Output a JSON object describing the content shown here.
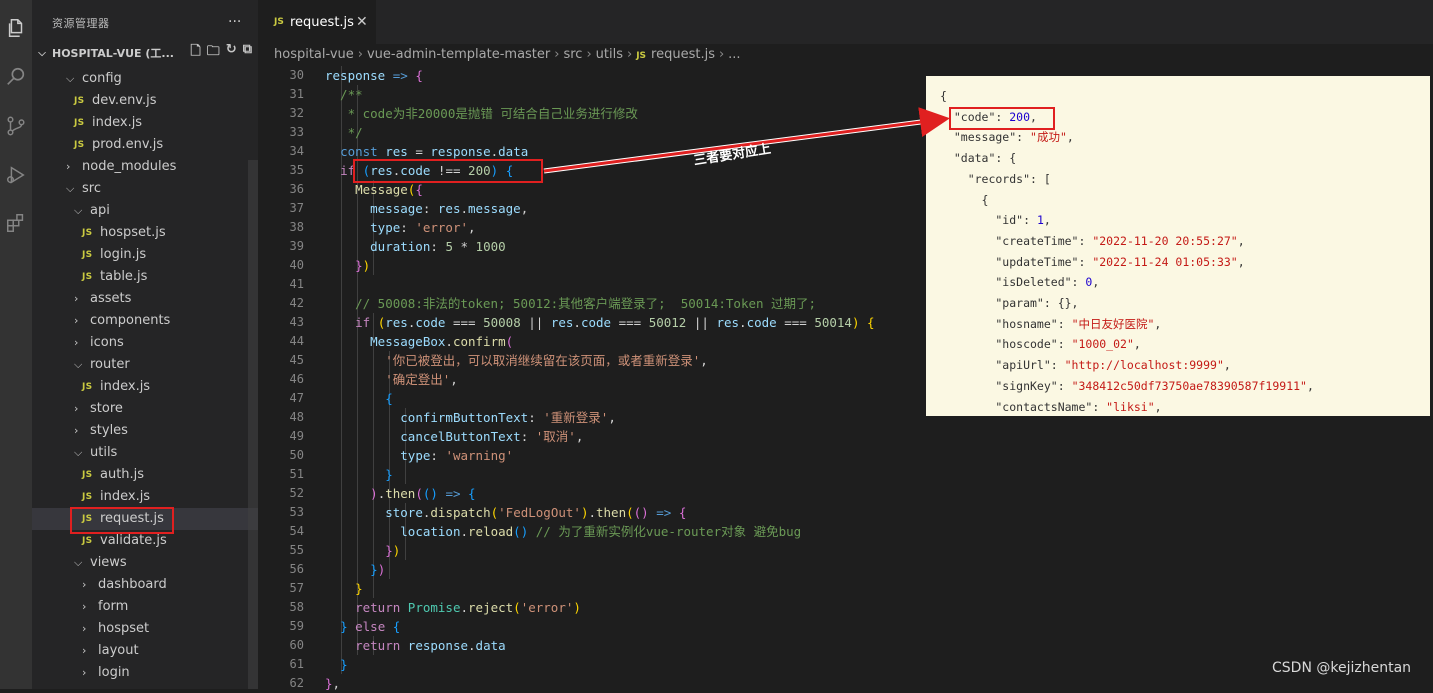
{
  "sidebar": {
    "title": "资源管理器",
    "more": "···",
    "project": "HOSPITAL-VUE (工...",
    "tree": [
      {
        "name": "config",
        "type": "folder",
        "open": true,
        "depth": 1
      },
      {
        "name": "dev.env.js",
        "type": "js",
        "depth": 2,
        "active": true
      },
      {
        "name": "index.js",
        "type": "js",
        "depth": 2
      },
      {
        "name": "prod.env.js",
        "type": "js",
        "depth": 2
      },
      {
        "name": "node_modules",
        "type": "folder",
        "open": false,
        "depth": 1
      },
      {
        "name": "src",
        "type": "folder",
        "open": true,
        "depth": 1
      },
      {
        "name": "api",
        "type": "folder",
        "open": true,
        "depth": 2
      },
      {
        "name": "hospset.js",
        "type": "js",
        "depth": 3
      },
      {
        "name": "login.js",
        "type": "js",
        "depth": 3
      },
      {
        "name": "table.js",
        "type": "js",
        "depth": 3
      },
      {
        "name": "assets",
        "type": "folder",
        "open": false,
        "depth": 2
      },
      {
        "name": "components",
        "type": "folder",
        "open": false,
        "depth": 2
      },
      {
        "name": "icons",
        "type": "folder",
        "open": false,
        "depth": 2
      },
      {
        "name": "router",
        "type": "folder",
        "open": true,
        "depth": 2
      },
      {
        "name": "index.js",
        "type": "js",
        "depth": 3
      },
      {
        "name": "store",
        "type": "folder",
        "open": false,
        "depth": 2
      },
      {
        "name": "styles",
        "type": "folder",
        "open": false,
        "depth": 2
      },
      {
        "name": "utils",
        "type": "folder",
        "open": true,
        "depth": 2
      },
      {
        "name": "auth.js",
        "type": "js",
        "depth": 3
      },
      {
        "name": "index.js",
        "type": "js",
        "depth": 3
      },
      {
        "name": "request.js",
        "type": "js",
        "depth": 3,
        "selected": true
      },
      {
        "name": "validate.js",
        "type": "js",
        "depth": 3
      },
      {
        "name": "views",
        "type": "folder",
        "open": true,
        "depth": 2
      },
      {
        "name": "dashboard",
        "type": "folder",
        "open": false,
        "depth": 3
      },
      {
        "name": "form",
        "type": "folder",
        "open": false,
        "depth": 3
      },
      {
        "name": "hospset",
        "type": "folder",
        "open": false,
        "depth": 3
      },
      {
        "name": "layout",
        "type": "folder",
        "open": false,
        "depth": 3
      },
      {
        "name": "login",
        "type": "folder",
        "open": false,
        "depth": 3
      }
    ]
  },
  "tab": {
    "icon": "JS",
    "name": "request.js",
    "close": "✕"
  },
  "breadcrumb": {
    "parts": [
      "hospital-vue",
      "vue-admin-template-master",
      "src",
      "utils"
    ],
    "file_icon": "JS",
    "file": "request.js",
    "tail": "..."
  },
  "code": {
    "line_numbers": [
      30,
      31,
      32,
      33,
      34,
      35,
      36,
      37,
      38,
      39,
      40,
      41,
      42,
      43,
      44,
      45,
      46,
      47,
      48,
      49,
      50,
      51,
      52,
      53,
      54,
      55,
      56,
      57,
      58,
      59,
      60,
      61,
      62
    ],
    "lines": [
      [
        [
          0,
          "p",
          ""
        ],
        [
          0,
          "var",
          "response"
        ],
        [
          0,
          "p",
          " "
        ],
        [
          0,
          "kw",
          "=>"
        ],
        [
          0,
          "p",
          " "
        ],
        [
          0,
          "b2",
          "{"
        ]
      ],
      [
        [
          0,
          "cm",
          "  /**"
        ]
      ],
      [
        [
          0,
          "cm",
          "   * code为非20000是抛错 可结合自己业务进行修改"
        ]
      ],
      [
        [
          0,
          "cm",
          "   */"
        ]
      ],
      [
        [
          0,
          "p",
          "  "
        ],
        [
          0,
          "kw",
          "const"
        ],
        [
          0,
          "p",
          " "
        ],
        [
          0,
          "var",
          "res"
        ],
        [
          0,
          "p",
          " = "
        ],
        [
          0,
          "var",
          "response"
        ],
        [
          0,
          "p",
          "."
        ],
        [
          0,
          "var",
          "data"
        ]
      ],
      [
        [
          0,
          "p",
          "  "
        ],
        [
          0,
          "ctl",
          "if"
        ],
        [
          0,
          "p",
          " "
        ],
        [
          0,
          "b3",
          "("
        ],
        [
          0,
          "var",
          "res"
        ],
        [
          0,
          "p",
          "."
        ],
        [
          0,
          "var",
          "code"
        ],
        [
          0,
          "p",
          " !== "
        ],
        [
          0,
          "num",
          "200"
        ],
        [
          0,
          "b3",
          ")"
        ],
        [
          0,
          "p",
          " "
        ],
        [
          0,
          "b3",
          "{"
        ]
      ],
      [
        [
          0,
          "p",
          "    "
        ],
        [
          0,
          "fn",
          "Message"
        ],
        [
          0,
          "b1",
          "("
        ],
        [
          0,
          "b2",
          "{"
        ]
      ],
      [
        [
          0,
          "p",
          "      "
        ],
        [
          0,
          "var",
          "message"
        ],
        [
          0,
          "p",
          ": "
        ],
        [
          0,
          "var",
          "res"
        ],
        [
          0,
          "p",
          "."
        ],
        [
          0,
          "var",
          "message"
        ],
        [
          0,
          "p",
          ","
        ]
      ],
      [
        [
          0,
          "p",
          "      "
        ],
        [
          0,
          "var",
          "type"
        ],
        [
          0,
          "p",
          ": "
        ],
        [
          0,
          "str",
          "'error'"
        ],
        [
          0,
          "p",
          ","
        ]
      ],
      [
        [
          0,
          "p",
          "      "
        ],
        [
          0,
          "var",
          "duration"
        ],
        [
          0,
          "p",
          ": "
        ],
        [
          0,
          "num",
          "5"
        ],
        [
          0,
          "p",
          " * "
        ],
        [
          0,
          "num",
          "1000"
        ]
      ],
      [
        [
          0,
          "p",
          "    "
        ],
        [
          0,
          "b2",
          "}"
        ],
        [
          0,
          "b1",
          ")"
        ]
      ],
      [
        [
          0,
          "p",
          ""
        ]
      ],
      [
        [
          0,
          "p",
          "    "
        ],
        [
          0,
          "cm",
          "// 50008:非法的token; 50012:其他客户端登录了;  50014:Token 过期了;"
        ]
      ],
      [
        [
          0,
          "p",
          "    "
        ],
        [
          0,
          "ctl",
          "if"
        ],
        [
          0,
          "p",
          " "
        ],
        [
          0,
          "b1",
          "("
        ],
        [
          0,
          "var",
          "res"
        ],
        [
          0,
          "p",
          "."
        ],
        [
          0,
          "var",
          "code"
        ],
        [
          0,
          "p",
          " === "
        ],
        [
          0,
          "num",
          "50008"
        ],
        [
          0,
          "p",
          " || "
        ],
        [
          0,
          "var",
          "res"
        ],
        [
          0,
          "p",
          "."
        ],
        [
          0,
          "var",
          "code"
        ],
        [
          0,
          "p",
          " === "
        ],
        [
          0,
          "num",
          "50012"
        ],
        [
          0,
          "p",
          " || "
        ],
        [
          0,
          "var",
          "res"
        ],
        [
          0,
          "p",
          "."
        ],
        [
          0,
          "var",
          "code"
        ],
        [
          0,
          "p",
          " === "
        ],
        [
          0,
          "num",
          "50014"
        ],
        [
          0,
          "b1",
          ")"
        ],
        [
          0,
          "p",
          " "
        ],
        [
          0,
          "b1",
          "{"
        ]
      ],
      [
        [
          0,
          "p",
          "      "
        ],
        [
          0,
          "var",
          "MessageBox"
        ],
        [
          0,
          "p",
          "."
        ],
        [
          0,
          "fn",
          "confirm"
        ],
        [
          0,
          "b2",
          "("
        ]
      ],
      [
        [
          0,
          "p",
          "        "
        ],
        [
          0,
          "str",
          "'你已被登出，可以取消继续留在该页面，或者重新登录'"
        ],
        [
          0,
          "p",
          ","
        ]
      ],
      [
        [
          0,
          "p",
          "        "
        ],
        [
          0,
          "str",
          "'确定登出'"
        ],
        [
          0,
          "p",
          ","
        ]
      ],
      [
        [
          0,
          "p",
          "        "
        ],
        [
          0,
          "b3",
          "{"
        ]
      ],
      [
        [
          0,
          "p",
          "          "
        ],
        [
          0,
          "var",
          "confirmButtonText"
        ],
        [
          0,
          "p",
          ": "
        ],
        [
          0,
          "str",
          "'重新登录'"
        ],
        [
          0,
          "p",
          ","
        ]
      ],
      [
        [
          0,
          "p",
          "          "
        ],
        [
          0,
          "var",
          "cancelButtonText"
        ],
        [
          0,
          "p",
          ": "
        ],
        [
          0,
          "str",
          "'取消'"
        ],
        [
          0,
          "p",
          ","
        ]
      ],
      [
        [
          0,
          "p",
          "          "
        ],
        [
          0,
          "var",
          "type"
        ],
        [
          0,
          "p",
          ": "
        ],
        [
          0,
          "str",
          "'warning'"
        ]
      ],
      [
        [
          0,
          "p",
          "        "
        ],
        [
          0,
          "b3",
          "}"
        ]
      ],
      [
        [
          0,
          "p",
          "      "
        ],
        [
          0,
          "b2",
          ")"
        ],
        [
          0,
          "p",
          "."
        ],
        [
          0,
          "fn",
          "then"
        ],
        [
          0,
          "b2",
          "("
        ],
        [
          0,
          "b3",
          "()"
        ],
        [
          0,
          "p",
          " "
        ],
        [
          0,
          "kw",
          "=>"
        ],
        [
          0,
          "p",
          " "
        ],
        [
          0,
          "b3",
          "{"
        ]
      ],
      [
        [
          0,
          "p",
          "        "
        ],
        [
          0,
          "var",
          "store"
        ],
        [
          0,
          "p",
          "."
        ],
        [
          0,
          "fn",
          "dispatch"
        ],
        [
          0,
          "b1",
          "("
        ],
        [
          0,
          "str",
          "'FedLogOut'"
        ],
        [
          0,
          "b1",
          ")"
        ],
        [
          0,
          "p",
          "."
        ],
        [
          0,
          "fn",
          "then"
        ],
        [
          0,
          "b1",
          "("
        ],
        [
          0,
          "b2",
          "()"
        ],
        [
          0,
          "p",
          " "
        ],
        [
          0,
          "kw",
          "=>"
        ],
        [
          0,
          "p",
          " "
        ],
        [
          0,
          "b2",
          "{"
        ]
      ],
      [
        [
          0,
          "p",
          "          "
        ],
        [
          0,
          "var",
          "location"
        ],
        [
          0,
          "p",
          "."
        ],
        [
          0,
          "fn",
          "reload"
        ],
        [
          0,
          "b3",
          "()"
        ],
        [
          0,
          "p",
          " "
        ],
        [
          0,
          "cm",
          "// 为了重新实例化vue-router对象 避免bug"
        ]
      ],
      [
        [
          0,
          "p",
          "        "
        ],
        [
          0,
          "b2",
          "}"
        ],
        [
          0,
          "b1",
          ")"
        ]
      ],
      [
        [
          0,
          "p",
          "      "
        ],
        [
          0,
          "b3",
          "}"
        ],
        [
          0,
          "b2",
          ")"
        ]
      ],
      [
        [
          0,
          "p",
          "    "
        ],
        [
          0,
          "b1",
          "}"
        ]
      ],
      [
        [
          0,
          "p",
          "    "
        ],
        [
          0,
          "ctl",
          "return"
        ],
        [
          0,
          "p",
          " "
        ],
        [
          0,
          "cls",
          "Promise"
        ],
        [
          0,
          "p",
          "."
        ],
        [
          0,
          "fn",
          "reject"
        ],
        [
          0,
          "b1",
          "("
        ],
        [
          0,
          "str",
          "'error'"
        ],
        [
          0,
          "b1",
          ")"
        ]
      ],
      [
        [
          0,
          "p",
          "  "
        ],
        [
          0,
          "b3",
          "}"
        ],
        [
          0,
          "p",
          " "
        ],
        [
          0,
          "ctl",
          "else"
        ],
        [
          0,
          "p",
          " "
        ],
        [
          0,
          "b3",
          "{"
        ]
      ],
      [
        [
          0,
          "p",
          "    "
        ],
        [
          0,
          "ctl",
          "return"
        ],
        [
          0,
          "p",
          " "
        ],
        [
          0,
          "var",
          "response"
        ],
        [
          0,
          "p",
          "."
        ],
        [
          0,
          "var",
          "data"
        ]
      ],
      [
        [
          0,
          "p",
          "  "
        ],
        [
          0,
          "b3",
          "}"
        ]
      ],
      [
        [
          0,
          "b2",
          "}"
        ],
        [
          0,
          "p",
          ","
        ]
      ]
    ]
  },
  "json_overlay": {
    "lines": [
      [
        [
          0,
          "jk",
          "{"
        ]
      ],
      [
        [
          0,
          "jk",
          "  \"code\": "
        ],
        [
          0,
          "jn",
          "200"
        ],
        [
          0,
          "jk",
          ","
        ]
      ],
      [
        [
          0,
          "jk",
          "  \"message\": "
        ],
        [
          0,
          "js2",
          "\"成功\""
        ],
        [
          0,
          "jk",
          ","
        ]
      ],
      [
        [
          0,
          "jk",
          "  \"data\": {"
        ]
      ],
      [
        [
          0,
          "jk",
          "    \"records\": ["
        ]
      ],
      [
        [
          0,
          "jk",
          "      {"
        ]
      ],
      [
        [
          0,
          "jk",
          "        \"id\": "
        ],
        [
          0,
          "jn",
          "1"
        ],
        [
          0,
          "jk",
          ","
        ]
      ],
      [
        [
          0,
          "jk",
          "        \"createTime\": "
        ],
        [
          0,
          "js2",
          "\"2022-11-20 20:55:27\""
        ],
        [
          0,
          "jk",
          ","
        ]
      ],
      [
        [
          0,
          "jk",
          "        \"updateTime\": "
        ],
        [
          0,
          "js2",
          "\"2022-11-24 01:05:33\""
        ],
        [
          0,
          "jk",
          ","
        ]
      ],
      [
        [
          0,
          "jk",
          "        \"isDeleted\": "
        ],
        [
          0,
          "jn",
          "0"
        ],
        [
          0,
          "jk",
          ","
        ]
      ],
      [
        [
          0,
          "jk",
          "        \"param\": {},"
        ]
      ],
      [
        [
          0,
          "jk",
          "        \"hosname\": "
        ],
        [
          0,
          "js2",
          "\"中日友好医院\""
        ],
        [
          0,
          "jk",
          ","
        ]
      ],
      [
        [
          0,
          "jk",
          "        \"hoscode\": "
        ],
        [
          0,
          "js2",
          "\"1000_02\""
        ],
        [
          0,
          "jk",
          ","
        ]
      ],
      [
        [
          0,
          "jk",
          "        \"apiUrl\": "
        ],
        [
          0,
          "js2",
          "\"http://localhost:9999\""
        ],
        [
          0,
          "jk",
          ","
        ]
      ],
      [
        [
          0,
          "jk",
          "        \"signKey\": "
        ],
        [
          0,
          "js2",
          "\"348412c50df73750ae78390587f19911\""
        ],
        [
          0,
          "jk",
          ","
        ]
      ],
      [
        [
          0,
          "jk",
          "        \"contactsName\": "
        ],
        [
          0,
          "js2",
          "\"liksi\""
        ],
        [
          0,
          "jk",
          ","
        ]
      ]
    ]
  },
  "annotation": {
    "text": "三者要对应上",
    "color": "#e02020"
  },
  "watermark": "CSDN @kejizhentan",
  "colors": {
    "editor_bg": "#1e1e1e",
    "sidebar_bg": "#252526",
    "activity_bg": "#333333",
    "highlight": "#e02020",
    "json_bg": "#fbf8e3"
  },
  "activity_icons": [
    "files-icon",
    "search-icon",
    "source-control-icon",
    "run-debug-icon",
    "extensions-icon"
  ]
}
